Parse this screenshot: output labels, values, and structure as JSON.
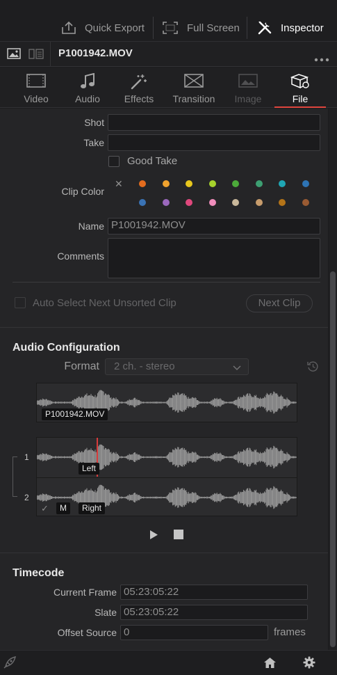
{
  "toolbar": {
    "quick_export": "Quick Export",
    "full_screen": "Full Screen",
    "inspector": "Inspector"
  },
  "clip": {
    "name": "P1001942.MOV"
  },
  "tabs": [
    {
      "label": "Video",
      "icon": "video-icon",
      "state": "normal"
    },
    {
      "label": "Audio",
      "icon": "music-note-icon",
      "state": "normal"
    },
    {
      "label": "Effects",
      "icon": "magic-wand-icon",
      "state": "normal"
    },
    {
      "label": "Transition",
      "icon": "transition-icon",
      "state": "normal"
    },
    {
      "label": "Image",
      "icon": "image-icon",
      "state": "disabled"
    },
    {
      "label": "File",
      "icon": "file-icon",
      "state": "active"
    }
  ],
  "file": {
    "shot_label": "Shot",
    "shot_value": "",
    "take_label": "Take",
    "take_value": "",
    "good_take_label": "Good Take",
    "clip_color_label": "Clip Color",
    "clip_colors": [
      "#e36c1e",
      "#f0a22e",
      "#e7c71d",
      "#a6d22c",
      "#4caa3a",
      "#3d9f72",
      "#1fa6b4",
      "#2e74b5",
      "#3a73b5",
      "#9b68bd",
      "#e0487d",
      "#f08dbb",
      "#c9b89b",
      "#c79c6c",
      "#b47418",
      "#9a5b33"
    ],
    "name_label": "Name",
    "name_value": "P1001942.MOV",
    "comments_label": "Comments",
    "comments_value": "",
    "auto_select_label": "Auto Select Next Unsorted Clip",
    "next_clip_label": "Next Clip"
  },
  "audio": {
    "title": "Audio Configuration",
    "format_label": "Format",
    "format_value": "2 ch. - stereo",
    "master_chip": "P1001942.MOV",
    "channel_1": "1",
    "channel_2": "2",
    "left_chip": "Left",
    "right_chip": "Right",
    "mute_chip": "M",
    "check_mark": "✓"
  },
  "timecode": {
    "title": "Timecode",
    "current_frame_label": "Current Frame",
    "current_frame_value": "05:23:05:22",
    "slate_label": "Slate",
    "slate_value": "05:23:05:22",
    "offset_label": "Offset Source",
    "offset_value": "0",
    "offset_unit": "frames"
  },
  "colors": {
    "accent_red": "#e0463e",
    "playhead": "#d83b3b"
  }
}
